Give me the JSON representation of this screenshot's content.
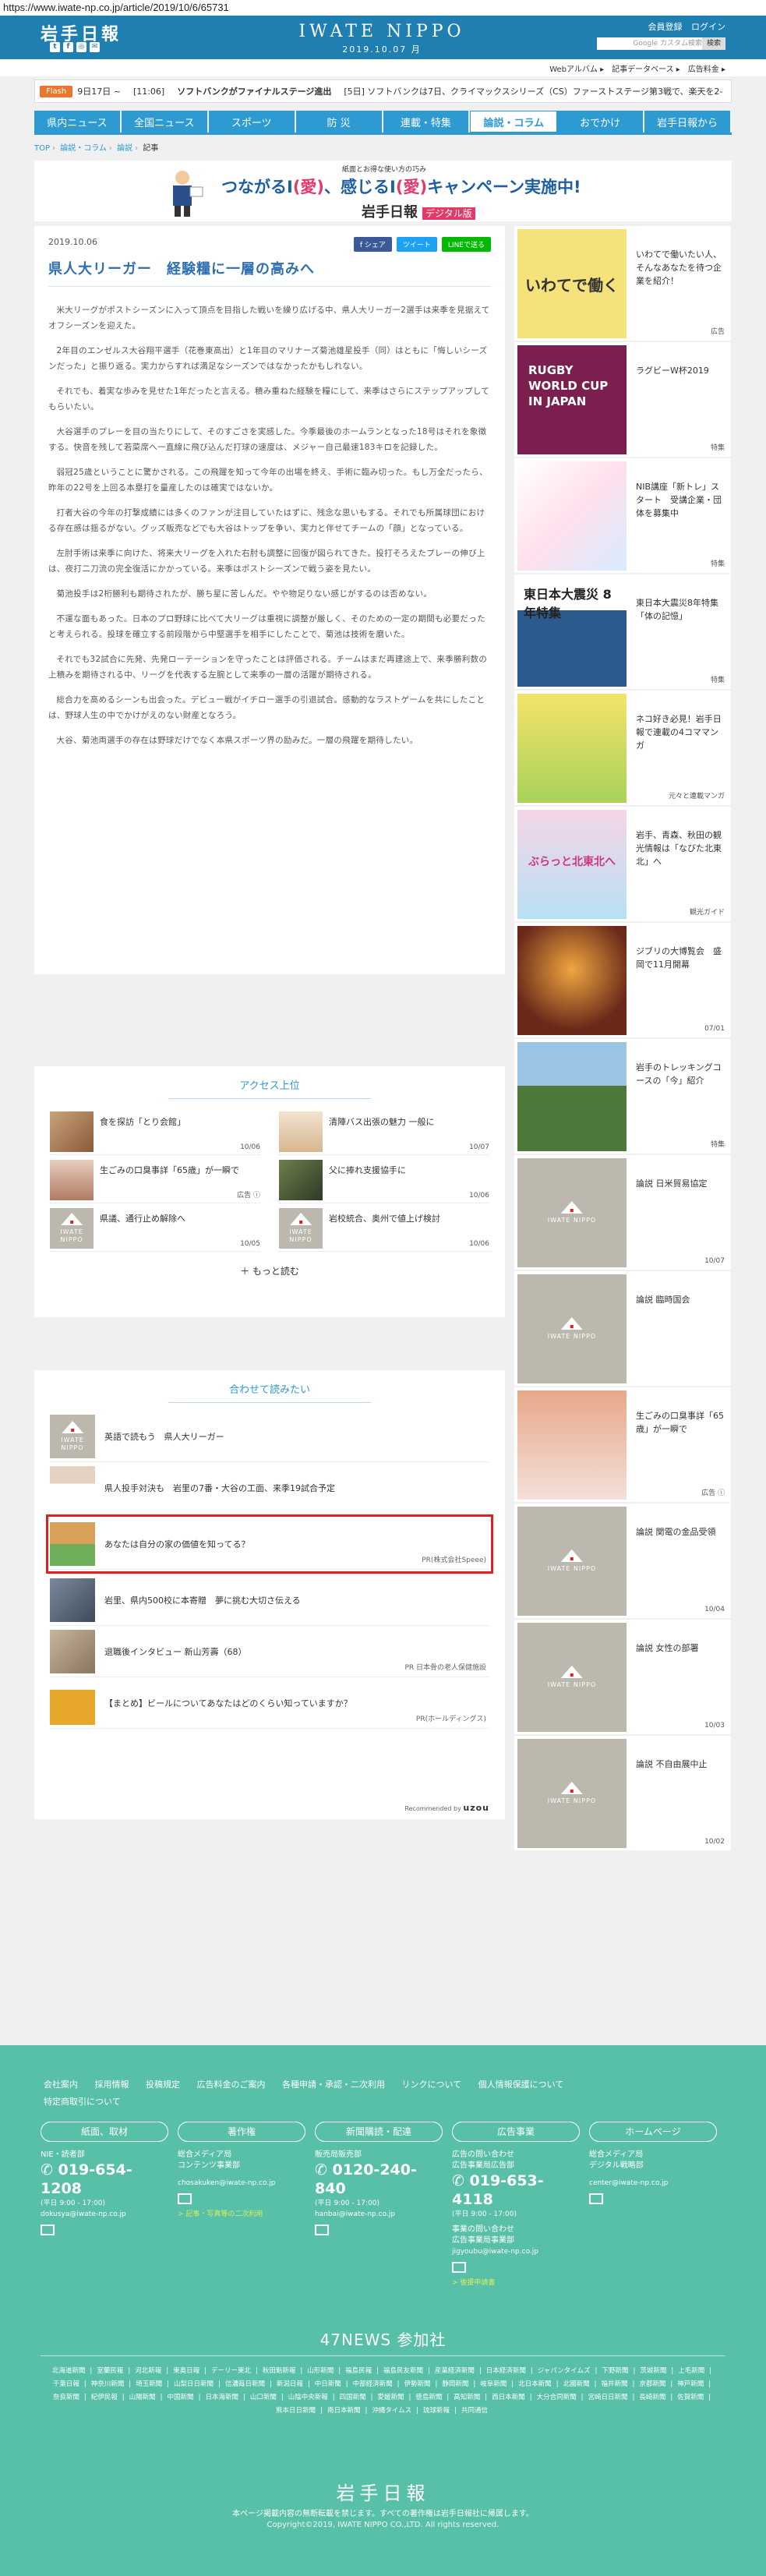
{
  "browser": {
    "url": "https://www.iwate-np.co.jp/article/2019/10/6/65731"
  },
  "header": {
    "logo": "岩手日報",
    "brand": "IWATE NIPPO",
    "date": "2019.10.07 月",
    "links": [
      "会員登録",
      "ログイン"
    ],
    "search_placeholder": "Google カスタム検索",
    "search_button": "検索",
    "subnav": [
      "Webアルバム ▸",
      "記事データベース ▸",
      "広告料金 ▸"
    ]
  },
  "flash": {
    "label": "Flash",
    "items": [
      "9日17日 ~",
      "[11:06]",
      "ソフトバンクがファイナルステージ進出",
      "[5日] ソフトバンクは7日、クライマックスシリーズ（CS）ファーストステージ第3戦で、楽天を2-"
    ]
  },
  "nav": {
    "items": [
      "県内ニュース",
      "全国ニュース",
      "スポーツ",
      "防 災",
      "連載・特集",
      "論説・コラム",
      "おでかけ",
      "岩手日報から"
    ],
    "active_index": 5
  },
  "breadcrumb": [
    "TOP",
    "論説・コラム",
    "論説",
    "記事"
  ],
  "banner": {
    "top": "紙面とお得な使い方の巧み",
    "main_pre": "つながるI",
    "main_em1": "(愛)",
    "main_mid": "、感じるI",
    "main_em2": "(愛)",
    "main_post": "キャンペーン実施中!",
    "sub": "岩手日報",
    "sub_tag": "デジタル版"
  },
  "article": {
    "date": "2019.10.06",
    "share": [
      "f シェア",
      "ツイート",
      "LINEで送る"
    ],
    "title": "県人大リーガー　経験糧に一層の高みへ",
    "paragraphs": [
      "米大リーグがポストシーズンに入って頂点を目指した戦いを繰り広げる中、県人大リーガー2選手は来季を見据えてオフシーズンを迎えた。",
      "2年目のエンゼルス大谷翔平選手（花巻東高出）と1年目のマリナーズ菊池雄星投手（同）はともに「悔しいシーズンだった」と振り返る。実力からすれば満足なシーズンではなかったかもしれない。",
      "それでも、着実な歩みを見せた1年だったと言える。積み重ねた経験を糧にして、来季はさらにステップアップしてもらいたい。",
      "大谷選手のプレーを目の当たりにして、そのすごさを実感した。今季最後のホームランとなった18号はそれを象徴する。快音を残して若菜席へ一直線に飛び込んだ打球の速度は、メジャー自己最速183キロを記録した。",
      "弱冠25歳ということに驚かされる。この飛躍を知って今年の出場を終え、手術に臨み切った。もし万全だったら、昨年の22号を上回る本塁打を量産したのは確実ではないか。",
      "打者大谷の今年の打撃成績には多くのファンが注目していたはずに、残念な思いもする。それでも所属球団における存在感は揺るがない。グッズ販売などでも大谷はトップを争い、実力と伴せてチームの「顔」となっている。",
      "左肘手術は来季に向けた、将来大リーグを入れた右肘も調整に回復が図られてきた。投打そろえたプレーの伸び上は、夜打二刀流の完全復活にかかっている。来季はポストシーズンで戦う姿を見たい。",
      "菊池投手は2桁勝利も期待されたが、勝ち星に苦しんだ。やや物足りない感じがするのは否めない。",
      "不運な面もあった。日本のプロ野球に比べて大リーグは重視に調整が厳しく、そのための一定の期間も必要だったと考えられる。投球を確立する前段階から中堅選手を相手にしたことで、菊池は技術を磨いた。",
      "それでも32試合に先発、先発ローテーションを守ったことは評価される。チームはまだ再建途上で、来季勝利数の上積みを期待される中、リーグを代表する左腕として来季の一層の活躍が期待される。",
      "総合力を高めるシーンも出会った。デビュー戦がイチロー選手の引退試合。感動的なラストゲームを共にしたことは、野球人生の中でかけがえのない財産となろう。",
      "大谷、菊池両選手の存在は野球だけでなく本県スポーツ界の励みだ。一層の飛躍を期待したい。"
    ]
  },
  "ranking": {
    "title": "アクセス上位",
    "items": [
      {
        "title": "食を探訪「とり会館」",
        "date": "10/06"
      },
      {
        "title": "清陣バス出張の魅力 一般に",
        "date": "10/07"
      },
      {
        "title": "生ごみの口臭事詳「65歳」が一瞬で",
        "date": "広告",
        "meta": "ⓘ"
      },
      {
        "title": "父に捧れ支援協手に",
        "date": "10/06"
      },
      {
        "title": "県議、通行止め解除へ",
        "date": "10/05"
      },
      {
        "title": "岩校統合、奥州で値上げ検討",
        "date": "10/06"
      }
    ],
    "more": "もっと読む"
  },
  "together": {
    "title": "合わせて読みたい",
    "items": [
      {
        "title": "英語で読もう　県人大リーガー",
        "pr": ""
      },
      {
        "title": "県人投手対決も　岩里の7番・大谷の工面、来季19試合予定",
        "pr": ""
      },
      {
        "title": "あなたは自分の家の価値を知ってる？",
        "pr": "PR(株式会社Speee)"
      },
      {
        "title": "岩里、県内500校に本寄贈　夢に挑む大切さ伝える",
        "pr": ""
      },
      {
        "title": "退職後インタビュー 新山芳壽（68）",
        "pr": "PR 日本骨の老人保健施設"
      },
      {
        "title": "【まとめ】ビールについてあなたはどのくらい知っていますか？",
        "pr": "PR(ホールディングス)"
      }
    ],
    "credit_pre": "Recommended by",
    "credit": "uzou"
  },
  "sidebar": [
    {
      "title": "いわてで働いたい人、そんなあなたを待つ企業を紹介！",
      "meta": "広告",
      "img": "いわてで働く"
    },
    {
      "title": "ラグビーW杯2019",
      "meta": "特集",
      "img": "RUGBY WORLD CUP IN JAPAN"
    },
    {
      "title": "NIB講座「新トレ」スタート　受講企業・団体を募集中",
      "meta": "特集",
      "img": ""
    },
    {
      "title": "東日本大震災8年特集「体の記憶」",
      "meta": "特集",
      "img": "東日本大震災 8年特集"
    },
    {
      "title": "ネコ好き必見！岩手日報で連載の4コママンガ",
      "meta": "元々と連載マンガ",
      "img": ""
    },
    {
      "title": "岩手、青森、秋田の観光情報は「なびた北東北」へ",
      "meta": "観光ガイド",
      "img": "ぶらっと北東北へ"
    },
    {
      "title": "ジブリの大博覧会　盛岡で11月開幕",
      "meta": "07/01",
      "img": ""
    },
    {
      "title": "岩手のトレッキングコースの「今」紹介",
      "meta": "特集",
      "img": ""
    },
    {
      "title": "論説 日米貿易協定",
      "meta": "10/07",
      "img": ""
    },
    {
      "title": "論説 臨時国会",
      "meta": "",
      "img": ""
    },
    {
      "title": "生ごみの口臭事詳「65歳」が一瞬で",
      "meta": "広告 ⓘ",
      "img": ""
    },
    {
      "title": "論説 関電の金品受領",
      "meta": "10/04",
      "img": ""
    },
    {
      "title": "論説 女性の部署",
      "meta": "10/03",
      "img": ""
    },
    {
      "title": "論説 不自由展中止",
      "meta": "10/02",
      "img": ""
    }
  ],
  "placeholder_logo": "IWATE NIPPO",
  "footer": {
    "links": [
      "会社案内",
      "採用情報",
      "投稿規定",
      "広告料金のご案内",
      "各種申請・承認・二次利用",
      "リンクについて",
      "個人情報保護について",
      "特定商取引について"
    ],
    "cols": [
      {
        "head": "紙面、取材",
        "l1": "NIE・読者部",
        "tel": "019-654-1208",
        "hours": "(平日 9:00 - 17:00)",
        "mail": "dokusya@iwate-np.co.jp",
        "extra": ""
      },
      {
        "head": "著作権",
        "l1": "総合メディア局",
        "l2": "コンテンツ事業部",
        "tel": "",
        "hours": "",
        "mail": "chosakuken@iwate-np.co.jp",
        "extra": "> 記事・写真等の二次利用"
      },
      {
        "head": "新聞購読・配達",
        "l1": "販売局販売部",
        "tel": "0120-240-840",
        "hours": "(平日 9:00 - 17:00)",
        "mail": "hanbai@iwate-np.co.jp",
        "extra": ""
      },
      {
        "head": "広告事業",
        "l1": "広告の問い合わせ",
        "l2": "広告事業局広告部",
        "tel": "019-653-4118",
        "hours": "(平日 9:00 - 17:00)",
        "l3": "事業の問い合わせ",
        "l4": "広告事業局事業部",
        "mail": "jigyoubu@iwate-np.co.jp",
        "extra": "> 後援申請書"
      },
      {
        "head": "ホームページ",
        "l1": "総合メディア局",
        "l2": "デジタル戦略部",
        "tel": "",
        "hours": "",
        "mail": "center@iwate-np.co.jp",
        "extra": ""
      }
    ],
    "news47": "47NEWS 参加社",
    "papers": [
      "北海道新聞",
      "室蘭民報",
      "河北新報",
      "東奥日報",
      "デーリー東北",
      "秋田魁新報",
      "山形新聞",
      "福島民報",
      "福島民友新聞",
      "産業経済新聞",
      "日本経済新聞",
      "ジャパンタイムズ",
      "下野新聞",
      "茨城新聞",
      "上毛新聞",
      "千葉日報",
      "神奈川新聞",
      "埼玉新聞",
      "山梨日日新聞",
      "信濃毎日新聞",
      "新潟日報",
      "中日新聞",
      "中部経済新聞",
      "伊勢新聞",
      "静岡新聞",
      "岐阜新聞",
      "北日本新聞",
      "北國新聞",
      "福井新聞",
      "京都新聞",
      "神戸新聞",
      "奈良新聞",
      "紀伊民報",
      "山陽新聞",
      "中国新聞",
      "日本海新聞",
      "山口新聞",
      "山陰中央新報",
      "四国新聞",
      "愛媛新聞",
      "徳島新聞",
      "高知新聞",
      "西日本新聞",
      "大分合同新聞",
      "宮崎日日新聞",
      "長崎新聞",
      "佐賀新聞",
      "熊本日日新聞",
      "南日本新聞",
      "沖縄タイムス",
      "琉球新報",
      "共同通信"
    ],
    "logo": "岩手日報",
    "note": "本ページ掲載内容の無断転載を禁じます。すべての著作権は岩手日報社に帰属します。",
    "copy": "Copyright©2019, IWATE NIPPO CO.,LTD. All rights reserved."
  },
  "colors": {
    "brand": "#1f7fb0",
    "nav": "#2d9bd2",
    "footer": "#58bfa8",
    "highlight": "#e21f1f"
  }
}
